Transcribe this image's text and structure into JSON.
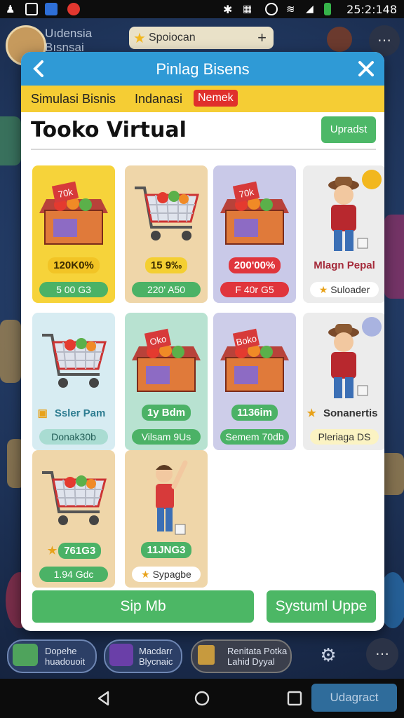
{
  "status_bar": {
    "time": "25:2:148"
  },
  "topbar": {
    "player_name_line1": "Uıdensia",
    "player_name_line2": "Bısnsai",
    "search_text": "Spoiocan",
    "search_add": "+"
  },
  "modal": {
    "title": "Pinlag Bisens",
    "banner_text1": "Simulasi Bisnis",
    "banner_text2": "Indanasi",
    "banner_badge": "Nemek",
    "store_title": "Tooko Virtual",
    "update_button": "Upradst",
    "ship_button": "Sip Mb",
    "system_button": "Systuml Uppe"
  },
  "cards": [
    {
      "name": "shop-item-produce-box-yellow",
      "art": "box",
      "box_label": "70k",
      "bg": "#f6d33a",
      "price": "120K0%",
      "price_color": "#3a2a00",
      "price_bg": "#f2c425",
      "pill": "5 00 G3",
      "pill_bg": "#4bb266",
      "pill_color": "#fff"
    },
    {
      "name": "shop-item-cart-red",
      "art": "cart",
      "bg": "#efd6a9",
      "price": "15 9‰",
      "price_color": "#3a2a00",
      "price_bg": "#f4cf32",
      "pill": "220' A50",
      "pill_bg": "#4bb266",
      "pill_color": "#fff"
    },
    {
      "name": "shop-item-produce-box-blue",
      "art": "box",
      "box_label": "70k",
      "bg": "#c9c9e8",
      "price": "200'00%",
      "price_color": "#fff",
      "price_bg": "#e0353c",
      "pill": "F 40r G5",
      "pill_bg": "#e0353c",
      "pill_color": "#fff"
    },
    {
      "name": "shop-item-merchant",
      "art": "person",
      "bg": "#ececec",
      "price": "Mlagn Pepal",
      "price_color": "#a52a3a",
      "price_bg": "transparent",
      "pill": "Suloader",
      "pill_bg": "#fff",
      "pill_color": "#333",
      "pill_star": true,
      "corner": "badge"
    },
    {
      "name": "shop-item-cart-blue",
      "art": "cart",
      "bg": "#d7ecf2",
      "price": "Ssler Pam",
      "price_color": "#2e7d91",
      "price_bg": "transparent",
      "price_box": true,
      "pill": "Donak30b",
      "pill_bg": "#a9dcd2",
      "pill_color": "#215c55"
    },
    {
      "name": "shop-item-produce-box-green",
      "art": "box",
      "box_label": "Oko",
      "bg": "#b8e2d1",
      "price": "1y Bdm",
      "price_color": "#fff",
      "price_bg": "#4bb266",
      "pill": "Vilsam 9Us",
      "pill_bg": "#4bb266",
      "pill_color": "#fff"
    },
    {
      "name": "shop-item-produce-box-lime",
      "art": "box",
      "box_label": "Boko",
      "bg": "#cdcde9",
      "price": "1136im",
      "price_color": "#fff",
      "price_bg": "#4bb266",
      "pill": "Semem 70db",
      "pill_bg": "#4bb266",
      "pill_color": "#fff"
    },
    {
      "name": "shop-item-shopkeeper",
      "art": "person",
      "bg": "#ececec",
      "price": "Sonanertis",
      "price_color": "#333",
      "price_bg": "transparent",
      "price_star": true,
      "pill": "Pleriaga DS",
      "pill_bg": "#fbf3c3",
      "pill_color": "#333",
      "corner": "user"
    },
    {
      "name": "shop-item-cart-purple",
      "art": "cart",
      "bg": "#efd6a9",
      "price": "761G3",
      "price_color": "#fff",
      "price_bg": "#4bb266",
      "price_star": true,
      "pill": "1.94 Gdc",
      "pill_bg": "#4bb266",
      "pill_color": "#fff"
    },
    {
      "name": "shop-item-worker",
      "art": "worker",
      "bg": "#efd6a9",
      "price": "11JNG3",
      "price_color": "#fff",
      "price_bg": "#4bb266",
      "pill": "Sypagbe",
      "pill_bg": "#fff",
      "pill_color": "#333",
      "pill_star": true
    }
  ],
  "bottom_bar": {
    "item1_line1": "Dopehe",
    "item1_line2": "huadouoit",
    "item2_line1": "Macdarr",
    "item2_line2": "Blycnaic",
    "item3_line1": "Renitata Potka",
    "item3_line2": "Lahid Dyyal"
  },
  "nav": {
    "update_button": "Udagract"
  }
}
